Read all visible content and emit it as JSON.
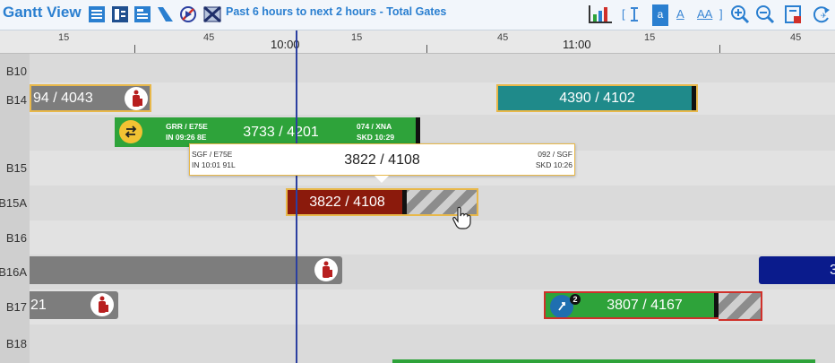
{
  "toolbar": {
    "title": "Gantt View",
    "range_label": "Past 6 hours to next 2 hours - Total Gates",
    "bracket_open": "[",
    "text_small_a": "a",
    "text_medium_a": "A",
    "text_aa": "AA",
    "bracket_close": "]",
    "icons": [
      "list-view-icon",
      "split-view-icon",
      "detail-view-icon",
      "ramp-icon",
      "no-flight-icon",
      "cross-map-icon",
      "bar-chart-icon",
      "text-cursor-icon",
      "zoom-in-icon",
      "zoom-out-icon",
      "print-icon",
      "refresh-icon"
    ]
  },
  "ruler": {
    "labels": [
      {
        "text": "15",
        "kind": "minute"
      },
      {
        "text": "45",
        "kind": "minute"
      },
      {
        "text": "10:00",
        "kind": "hour"
      },
      {
        "text": "15",
        "kind": "minute"
      },
      {
        "text": "45",
        "kind": "minute"
      },
      {
        "text": "11:00",
        "kind": "hour"
      },
      {
        "text": "15",
        "kind": "minute"
      },
      {
        "text": "45",
        "kind": "minute"
      }
    ]
  },
  "gates": [
    "B10",
    "B14",
    "",
    "B15",
    "B15A",
    "B16",
    "B16A",
    "B17",
    "B18"
  ],
  "flights": {
    "b14_left": {
      "label": "94 / 4043"
    },
    "b14_right": {
      "label": "4390 / 4102"
    },
    "grr": {
      "label": "3733 / 4201",
      "left_top": "GRR / E75E",
      "left_bottom": "IN 09:26 8E",
      "right_top": "074 / XNA",
      "right_bottom": "SKD 10:29"
    },
    "b15a": {
      "label": "3822 / 4108"
    },
    "b16a_right": {
      "label": "3"
    },
    "b17_left": {
      "label": "21"
    },
    "b17_right": {
      "label": "3807 / 4167",
      "badge": "2"
    }
  },
  "tooltip": {
    "main": "3822 / 4108",
    "left_top": "SGF / E75E",
    "left_bottom": "IN 10:01 91L",
    "right_top": "092 / SGF",
    "right_bottom": "SKD 10:26"
  },
  "colors": {
    "gray_bar": "#7d7d7d",
    "teal_bar": "#1f8a8a",
    "green_bar": "#2ea33a",
    "red_bar": "#8b1a0c",
    "navy_bar": "#0a1b8c",
    "now_line": "#2b3fa0",
    "accent": "#2a7fd0"
  }
}
